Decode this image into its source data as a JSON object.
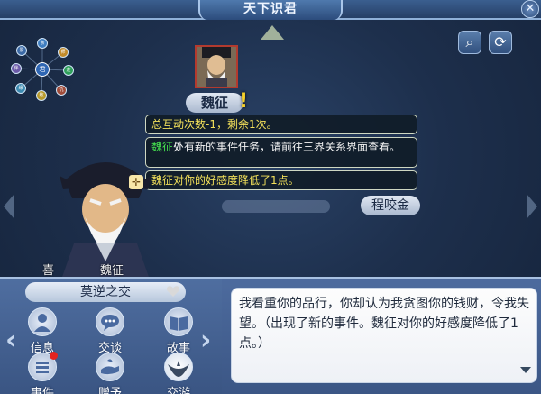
{
  "window": {
    "title": "天下识君",
    "close_symbol": "✕"
  },
  "toolbar": {
    "search_symbol": "⌕",
    "refresh_symbol": "⟳"
  },
  "constellation": {
    "center_label": "君",
    "nodes": [
      "亲",
      "师",
      "友",
      "仇",
      "敌",
      "缘",
      "伴",
      "爱"
    ]
  },
  "center_character": {
    "name": "魏征",
    "alert": "!"
  },
  "messages": {
    "line1": "总互动次数-1，剩余1次。",
    "line2_name": "魏征",
    "line2_rest": "处有新的事件任务，请前往三界关系界面查看。",
    "line3": "魏征对你的好感度降低了1点。"
  },
  "other_character": {
    "name": "程咬金"
  },
  "bust": {
    "mood_label": "喜",
    "name": "魏征"
  },
  "relation": {
    "title": "莫逆之交"
  },
  "actions": [
    {
      "label": "信息",
      "icon": "person-icon"
    },
    {
      "label": "交谈",
      "icon": "chat-icon"
    },
    {
      "label": "故事",
      "icon": "book-icon"
    },
    {
      "label": "事件",
      "icon": "list-icon",
      "has_notification": true
    },
    {
      "label": "赠予",
      "icon": "gift-hand-icon"
    },
    {
      "label": "交游",
      "icon": "bird-icon"
    }
  ],
  "dialogue": {
    "text": "我看重你的品行，你却认为我贪图你的钱财，令我失望。（出现了新的事件。魏征对你的好感度降低了1点。）"
  },
  "colors": {
    "highlight_green": "#45e04e",
    "message_yellow": "#f2e05a",
    "notify_red": "#e5241f"
  }
}
